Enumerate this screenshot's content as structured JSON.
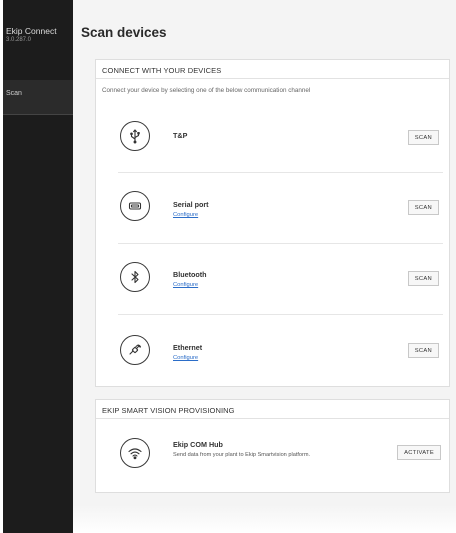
{
  "app": {
    "name": "Ekip Connect",
    "version": "3.0.287.0"
  },
  "sidebar": {
    "items": [
      {
        "label": "Scan",
        "active": true
      }
    ]
  },
  "page": {
    "title": "Scan devices"
  },
  "connect_section": {
    "title": "CONNECT WITH YOUR DEVICES",
    "subtitle": "Connect your device by selecting one of the below communication channel",
    "devices": [
      {
        "name": "T&P",
        "icon": "usb-icon",
        "button_label": "SCAN"
      },
      {
        "name": "Serial port",
        "link_label": "Configure",
        "icon": "serial-port-icon",
        "button_label": "SCAN"
      },
      {
        "name": "Bluetooth",
        "link_label": "Configure",
        "icon": "bluetooth-icon",
        "button_label": "SCAN"
      },
      {
        "name": "Ethernet",
        "link_label": "Configure",
        "icon": "ethernet-icon",
        "button_label": "SCAN"
      }
    ]
  },
  "provisioning_section": {
    "title": "EKIP SMART VISION PROVISIONING",
    "item": {
      "name": "Ekip COM Hub",
      "description": "Send data from your plant to Ekip Smartvision platform.",
      "icon": "wifi-icon",
      "button_label": "ACTIVATE"
    }
  },
  "colors": {
    "sidebar_bg": "#1c1c1c",
    "main_bg": "#f4f4f4",
    "link": "#2b6dc8"
  }
}
